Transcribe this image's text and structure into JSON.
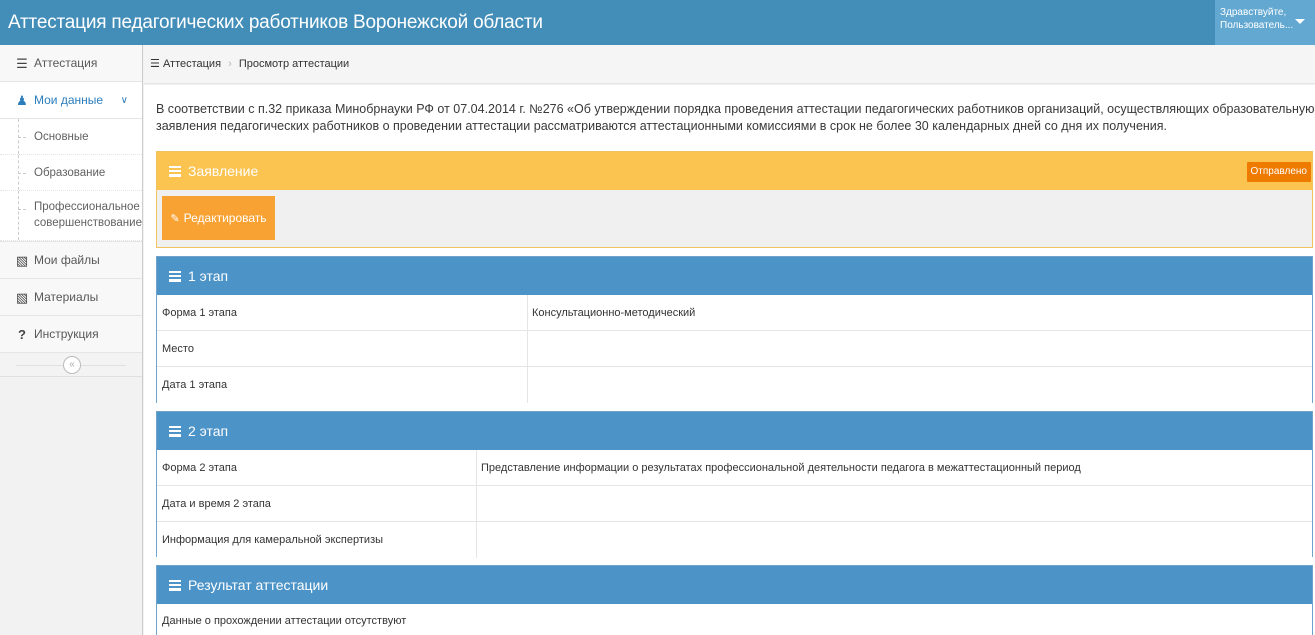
{
  "header": {
    "title": "Аттестация педагогических работников Воронежской области",
    "greeting": "Здравствуйте,",
    "username": "Пользователь..."
  },
  "sidebar": {
    "items": [
      {
        "label": "Аттестация",
        "icon": "list-icon"
      },
      {
        "label": "Мои данные",
        "icon": "user-icon",
        "open": true
      },
      {
        "label": "Мои файлы",
        "icon": "briefcase-icon"
      },
      {
        "label": "Материалы",
        "icon": "briefcase-icon"
      },
      {
        "label": "Инструкция",
        "icon": "question-icon"
      }
    ],
    "subitems": [
      "Основные",
      "Образование",
      "Профессиональное совершенствование"
    ]
  },
  "breadcrumbs": {
    "items": [
      "Аттестация",
      "Просмотр аттестации"
    ]
  },
  "main": {
    "intro_line1": "В соответствии с п.32 приказа Минобрнауки РФ от 07.04.2014 г. №276 «Об утверждении порядка проведения аттестации педагогических работников организаций, осуществляющих образовательную деятельность»",
    "intro_line2": "заявления педагогических работников о проведении аттестации рассматриваются аттестационными комиссиями в срок не более 30 календарных дней со дня их получения.",
    "application": {
      "title": "Заявление",
      "status": "Отправлено",
      "edit_label": "Редактировать"
    },
    "stage1": {
      "title": "1 этап",
      "rows": [
        {
          "key": "Форма 1 этапа",
          "value": "Консультационно-методический"
        },
        {
          "key": "Место",
          "value": ""
        },
        {
          "key": "Дата 1 этапа",
          "value": ""
        }
      ]
    },
    "stage2": {
      "title": "2 этап",
      "rows": [
        {
          "key": "Форма 2 этапа",
          "value": "Представление информации о результатах профессиональной деятельности педагога в межаттестационный период"
        },
        {
          "key": "Дата и время 2 этапа",
          "value": ""
        },
        {
          "key": "Информация для камеральной экспертизы",
          "value": ""
        }
      ]
    },
    "result": {
      "title": "Результат аттестации",
      "text": "Данные о прохождении аттестации отсутствуют"
    }
  },
  "colors": {
    "header": "#438eb9",
    "accent_orange": "#fbc350",
    "panel_blue": "#4c93c7",
    "badge_orange": "#ee7a00"
  }
}
